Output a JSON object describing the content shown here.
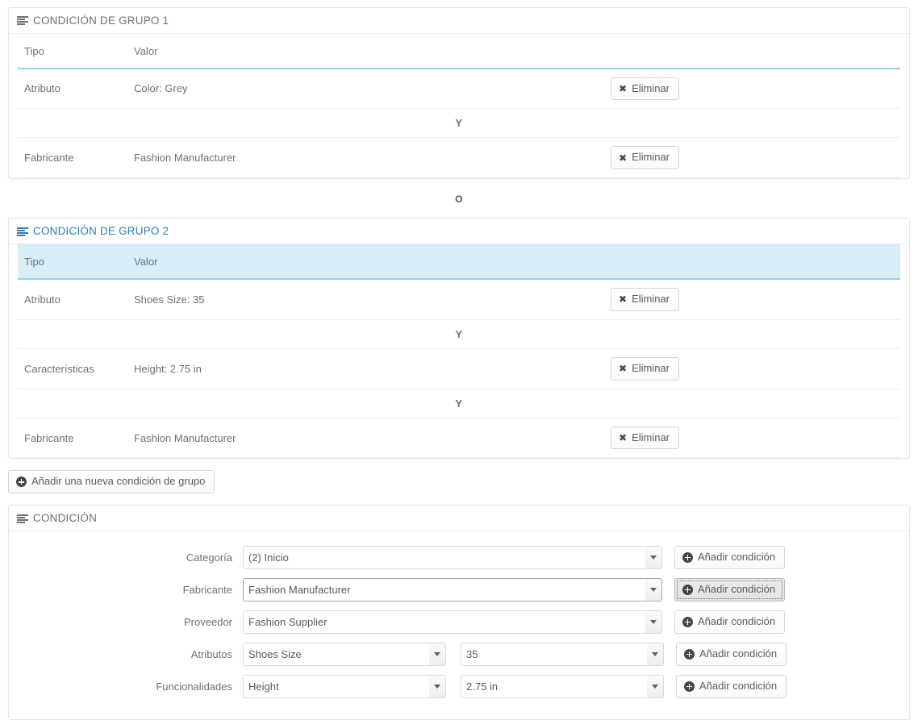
{
  "groups": [
    {
      "icon": "list-icon",
      "title": "CONDICIÓN DE GRUPO 1",
      "highlighted": false,
      "columns": {
        "tipo": "Tipo",
        "valor": "Valor"
      },
      "rows": [
        {
          "tipo": "Atributo",
          "valor": "Color: Grey",
          "action_label": "Eliminar",
          "action_icon": "times-icon"
        },
        {
          "tipo": "Fabricante",
          "valor": "Fashion Manufacturer",
          "action_label": "Eliminar",
          "action_icon": "times-icon"
        }
      ],
      "row_operator": "Y"
    },
    {
      "icon": "list-icon",
      "title": "CONDICIÓN DE GRUPO 2",
      "highlighted": true,
      "columns": {
        "tipo": "Tipo",
        "valor": "Valor"
      },
      "rows": [
        {
          "tipo": "Atributo",
          "valor": "Shoes Size: 35",
          "action_label": "Eliminar",
          "action_icon": "times-icon"
        },
        {
          "tipo": "Características",
          "valor": "Height: 2.75 in",
          "action_label": "Eliminar",
          "action_icon": "times-icon"
        },
        {
          "tipo": "Fabricante",
          "valor": "Fashion Manufacturer",
          "action_label": "Eliminar",
          "action_icon": "times-icon"
        }
      ],
      "row_operator": "Y"
    }
  ],
  "group_operator": "O",
  "add_group_button": {
    "label": "Añadir una nueva condición de grupo",
    "icon": "plus-circle-icon"
  },
  "condition_panel": {
    "icon": "list-icon",
    "title": "CONDICIÓN",
    "rows": [
      {
        "label": "Categoría",
        "select_value": "(2) Inicio",
        "button_label": "Añadir condición",
        "button_icon": "plus-circle-icon",
        "focused": false
      },
      {
        "label": "Fabricante",
        "select_value": "Fashion Manufacturer",
        "button_label": "Añadir condición",
        "button_icon": "plus-circle-icon",
        "focused": true
      },
      {
        "label": "Proveedor",
        "select_value": "Fashion Supplier",
        "button_label": "Añadir condición",
        "button_icon": "plus-circle-icon",
        "focused": false
      },
      {
        "label": "Atributos",
        "select_value": "Shoes Size",
        "select_value_2": "35",
        "button_label": "Añadir condición",
        "button_icon": "plus-circle-icon",
        "focused": false
      },
      {
        "label": "Funcionalidades",
        "select_value": "Height",
        "select_value_2": "2.75 in",
        "button_label": "Añadir condición",
        "button_icon": "plus-circle-icon",
        "focused": false
      }
    ]
  },
  "colors": {
    "accent_blue": "#2c7eb5",
    "header_underline": "#8ed4ef",
    "highlight_row": "#d9edf7",
    "text": "#6b7177",
    "panel_border": "#e5e5e5"
  }
}
